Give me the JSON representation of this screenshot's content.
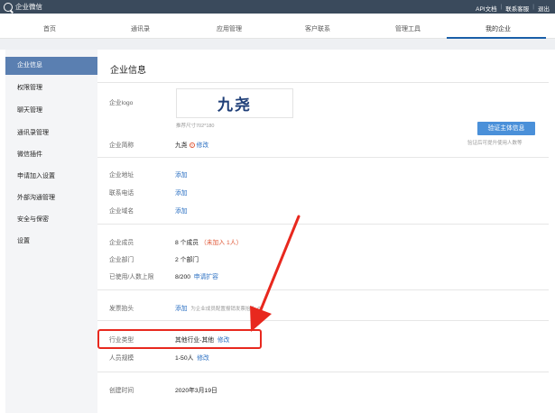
{
  "topbar": {
    "app_name": "企业微信",
    "links": [
      "API文档",
      "联系客服",
      "退出"
    ]
  },
  "nav": {
    "tabs": [
      "首页",
      "通讯录",
      "应用管理",
      "客户联系",
      "管理工具",
      "我的企业"
    ],
    "active": "我的企业"
  },
  "sidebar": {
    "items": [
      "企业信息",
      "权限管理",
      "聊天管理",
      "通讯录管理",
      "微信插件",
      "申请加入设置",
      "外部沟通管理",
      "安全与保密",
      "设置"
    ],
    "active": "企业信息"
  },
  "main": {
    "title": "企业信息",
    "logo": {
      "label": "企业logo",
      "text": "九尧",
      "hint": "推荐尺寸702*180"
    },
    "verify": {
      "button": "验证主体信息",
      "hint": "验证后可提升使用人数等"
    },
    "short_name": {
      "label": "企业简称",
      "value": "九尧",
      "action": "修改"
    },
    "address": {
      "label": "企业地址",
      "action": "添加"
    },
    "phone": {
      "label": "联系电话",
      "action": "添加"
    },
    "domain": {
      "label": "企业域名",
      "action": "添加"
    },
    "members": {
      "label": "企业成员",
      "value": "8 个成员",
      "note": "（未加入 1人）"
    },
    "departments": {
      "label": "企业部门",
      "value": "2 个部门"
    },
    "quota": {
      "label": "已使用/人数上限",
      "value": "8/200",
      "action": "申请扩容"
    },
    "invoice": {
      "label": "发票抬头",
      "action": "添加",
      "note": "为企业成员配置报销发票抬头"
    },
    "industry": {
      "label": "行业类型",
      "value": "其他行业-其他",
      "action": "修改"
    },
    "scale": {
      "label": "人员规模",
      "value": "1-50人",
      "action": "修改"
    },
    "created": {
      "label": "创建时间",
      "value": "2020年3月19日"
    }
  },
  "colors": {
    "topbar": "#3a4a5c",
    "sidebar_active": "#5a7fb1",
    "link": "#2a6fc2",
    "annotation": "#e8281e",
    "verify_button": "#4a90d9"
  }
}
